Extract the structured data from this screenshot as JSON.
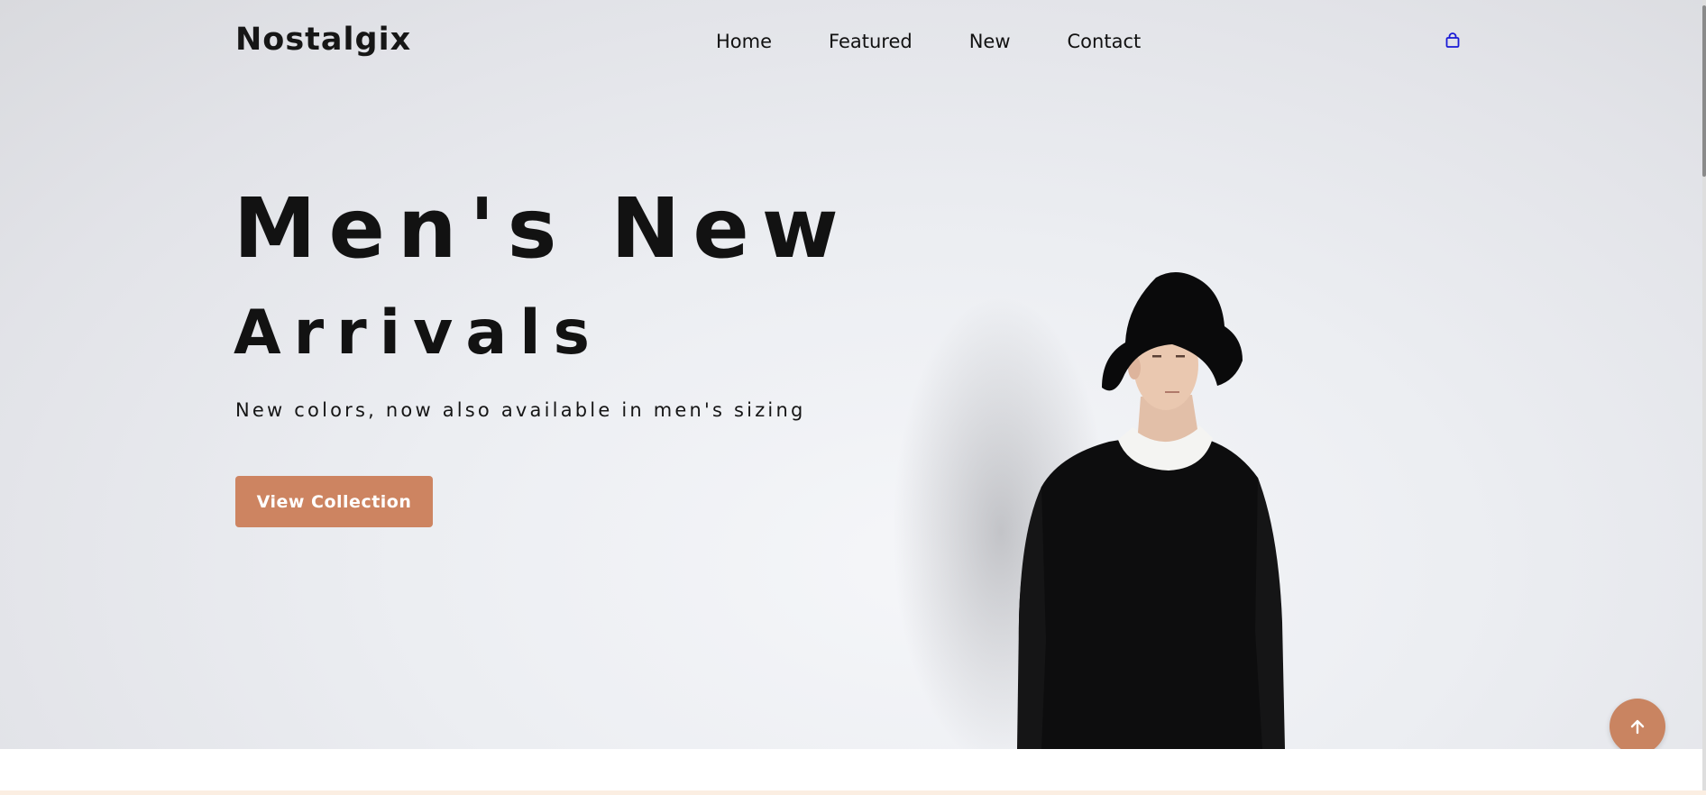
{
  "brand": {
    "logo": "Nostalgix"
  },
  "nav": {
    "items": [
      "Home",
      "Featured",
      "New",
      "Contact"
    ],
    "cart_icon": "shopping-bag-icon"
  },
  "hero": {
    "title_line1": "Men's New",
    "title_line2": "Arrivals",
    "subtitle": "New colors, now also available in men's sizing",
    "cta_label": "View Collection",
    "image": "man-in-bucket-hat-photo"
  },
  "scroll_top": {
    "icon": "arrow-up-icon"
  },
  "colors": {
    "accent": "#cd8461",
    "text": "#121212",
    "cart_icon": "#1a1ad6",
    "hero_bg": "#eceef2"
  }
}
